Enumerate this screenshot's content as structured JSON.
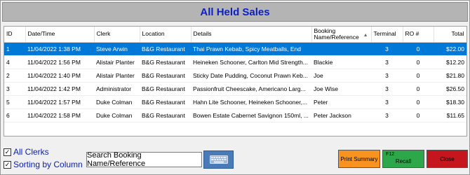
{
  "window": {
    "title": "All Held Sales"
  },
  "table": {
    "columns": [
      {
        "key": "id",
        "label": "ID"
      },
      {
        "key": "datetime",
        "label": "Date/Time"
      },
      {
        "key": "clerk",
        "label": "Clerk"
      },
      {
        "key": "location",
        "label": "Location"
      },
      {
        "key": "details",
        "label": "Details"
      },
      {
        "key": "booking",
        "label": "Booking Name/Reference"
      },
      {
        "key": "terminal",
        "label": "Terminal"
      },
      {
        "key": "ro",
        "label": "RO #"
      },
      {
        "key": "total",
        "label": "Total"
      }
    ],
    "sorted_column": "booking",
    "rows": [
      {
        "id": "1",
        "datetime": "11/04/2022 1:38 PM",
        "clerk": "Steve Arwin",
        "location": "B&G Restaurant",
        "details": "Thai Prawn Kebab, Spicy Meatballs, End",
        "booking": "",
        "terminal": "3",
        "ro": "0",
        "total": "$22.00",
        "selected": true
      },
      {
        "id": "4",
        "datetime": "11/04/2022 1:56 PM",
        "clerk": "Alistair Planter",
        "location": "B&G Restaurant",
        "details": "Heineken Schooner, Carlton Mid Strength...",
        "booking": "Blackie",
        "terminal": "3",
        "ro": "0",
        "total": "$12.20",
        "selected": false
      },
      {
        "id": "2",
        "datetime": "11/04/2022 1:40 PM",
        "clerk": "Alistair Planter",
        "location": "B&G Restaurant",
        "details": "Sticky Date Pudding, Coconut Prawn Keb...",
        "booking": "Joe",
        "terminal": "3",
        "ro": "0",
        "total": "$21.80",
        "selected": false
      },
      {
        "id": "3",
        "datetime": "11/04/2022 1:42 PM",
        "clerk": "Administrator",
        "location": "B&G Restaurant",
        "details": "Passionfruit Cheescake, Americano Larg...",
        "booking": "Joe Wise",
        "terminal": "3",
        "ro": "0",
        "total": "$26.50",
        "selected": false
      },
      {
        "id": "5",
        "datetime": "11/04/2022 1:57 PM",
        "clerk": "Duke Colman",
        "location": "B&G Restaurant",
        "details": "Hahn Lite Schooner, Heineken Schooner,...",
        "booking": "Peter",
        "terminal": "3",
        "ro": "0",
        "total": "$18.30",
        "selected": false
      },
      {
        "id": "6",
        "datetime": "11/04/2022 1:58 PM",
        "clerk": "Duke Colman",
        "location": "B&G Restaurant",
        "details": "Bowen Estate Cabernet Savignon 150ml, ...",
        "booking": "Peter Jackson",
        "terminal": "3",
        "ro": "0",
        "total": "$11.65",
        "selected": false
      }
    ]
  },
  "filters": {
    "all_clerks": {
      "label": "All Clerks",
      "checked": true
    },
    "sorting_by_column": {
      "label": "Sorting by Column",
      "checked": true
    }
  },
  "search": {
    "label": "Search Booking Name/Reference",
    "keyboard_icon": "keyboard-icon"
  },
  "buttons": {
    "print_summary": "Print Summary",
    "recall_fkey": "F12",
    "recall": "Recall",
    "close": "Close"
  },
  "colors": {
    "title": "#0b1fc6",
    "selected_row": "#0078d7",
    "print": "#f7931e",
    "recall": "#2ca84a",
    "close": "#c4161c"
  }
}
